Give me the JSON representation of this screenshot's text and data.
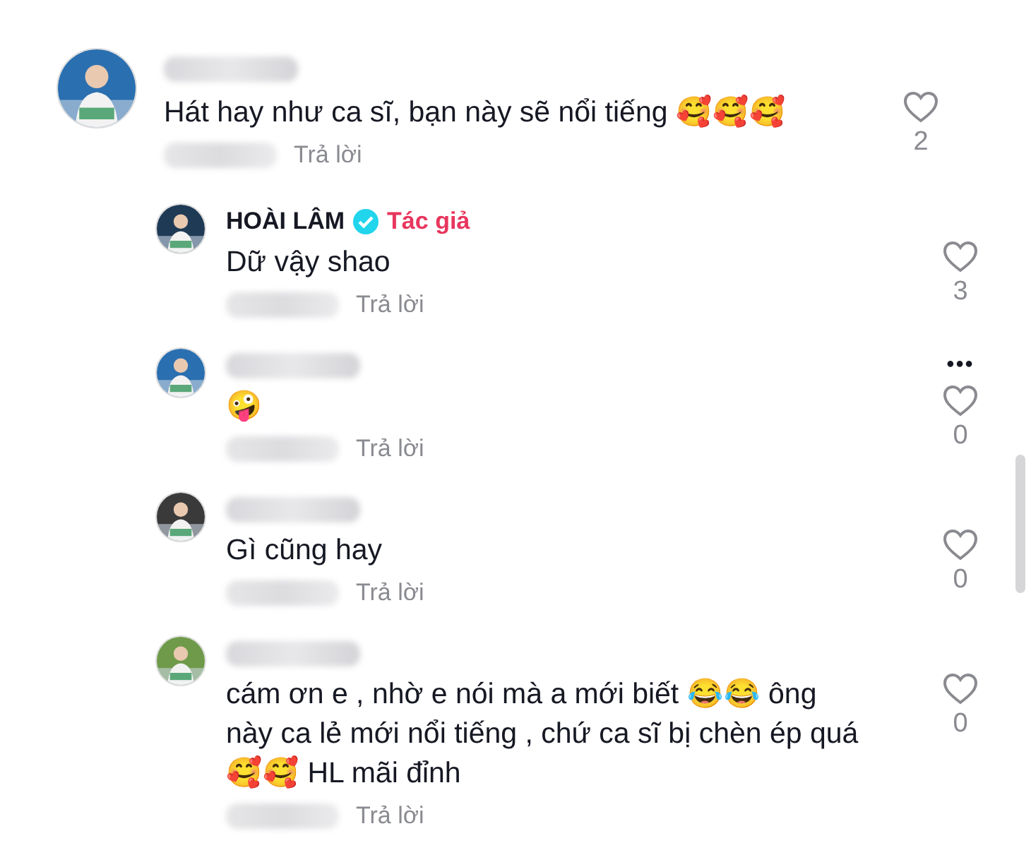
{
  "comments": [
    {
      "reply": false,
      "verified": false,
      "text": "Hát hay như ca sĩ, bạn này sẽ nổi tiếng 🥰🥰🥰",
      "reply_label": "Trả lời",
      "likes": "2"
    },
    {
      "reply": true,
      "author": "HOÀI LÂM",
      "verified": true,
      "badge": "Tác giả",
      "text": "Dữ vậy shao",
      "reply_label": "Trả lời",
      "likes": "3"
    },
    {
      "reply": true,
      "verified": false,
      "text": "🤪",
      "reply_label": "Trả lời",
      "likes": "0",
      "more": "•••"
    },
    {
      "reply": true,
      "verified": false,
      "text": "Gì cũng hay",
      "reply_label": "Trả lời",
      "likes": "0"
    },
    {
      "reply": true,
      "verified": false,
      "text": "cám ơn e , nhờ e nói mà a mới biết 😂😂 ông này ca lẻ mới nổi tiếng , chứ ca sĩ bị chèn ép quá 🥰🥰 HL mãi đỉnh",
      "reply_label": "Trả lời",
      "likes": "0"
    }
  ]
}
